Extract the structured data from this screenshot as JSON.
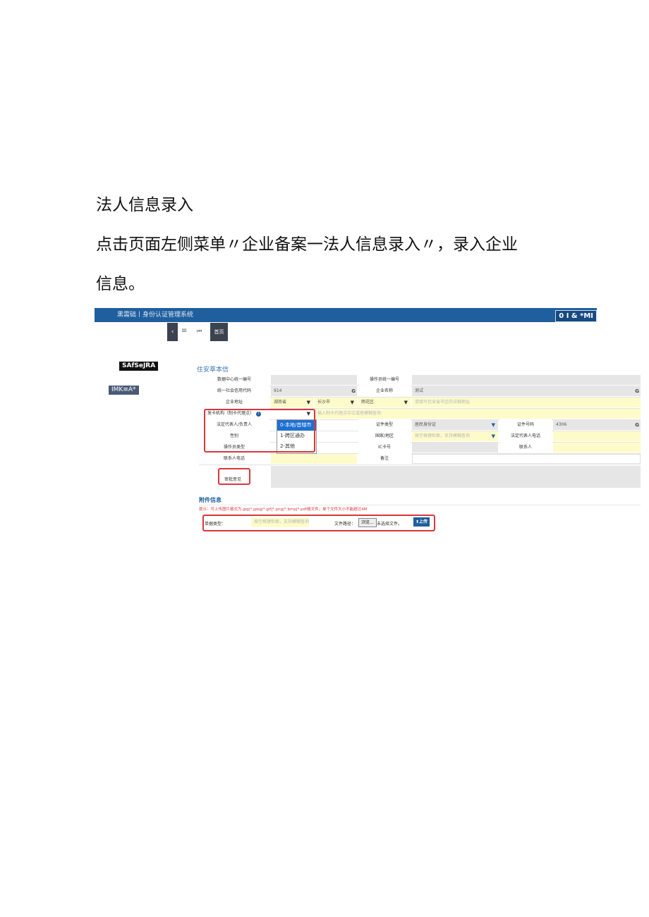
{
  "doc": {
    "heading": "法人信息录入",
    "paragraph_line1": "点击页面左侧菜单〃企业备案一法人信息录入〃，录入企业",
    "paragraph_line2": "信息。"
  },
  "screenshot": {
    "topbar": {
      "brand": "黑需础丨身份认证管理系统",
      "tools": "0 I & *MI"
    },
    "tabs": {
      "back_icon": "‹",
      "menu_icon": "≡",
      "prev_icon": "⏮",
      "home": "首页"
    },
    "sidebar": {
      "item1": "SAfSeJRA",
      "item2": "IMK≡A*"
    },
    "section_title": "住安萃本信",
    "form": {
      "r1": {
        "label_a": "数据中心统一编号",
        "label_b": "操作员统一编号"
      },
      "r2": {
        "label_a": "统一社会信用代码",
        "value_a": "914",
        "label_b": "企业名称",
        "value_b": "测试"
      },
      "r3": {
        "label_a": "企业地址",
        "province": "湖南省",
        "city": "长沙市",
        "district": "雨花区",
        "detail_ph": "请填写包含省市区的详细地址"
      },
      "r4": {
        "label_a": "发卡机构（制卡代理点）",
        "hint": "输入制卡代理点中文或者模糊查询"
      },
      "r5": {
        "label_a": "法定代表人/负责人",
        "label_b": "证件类型",
        "value_b": "居民身份证",
        "label_c": "证件号码",
        "value_c": "4306"
      },
      "r6": {
        "label_a": "性别",
        "label_b": "国家/地区",
        "value_b_ph": "按空格键检索，支持模糊查询",
        "label_c": "法定代表人电话"
      },
      "r7": {
        "label_a": "操作员类型",
        "label_b": "IC卡号",
        "label_c": "联系人"
      },
      "r8": {
        "label_a": "联系人电话",
        "label_b": "备注"
      },
      "approval": "审批意见"
    },
    "dropdown": {
      "options": [
        "0-本地/首辖市",
        "1-跨区通办",
        "2-其他"
      ],
      "selected_index": 0
    },
    "attachment": {
      "title": "附件信息",
      "note": "提示：可上传图片格式为.jpg|*.jpeg|*.gif|*.png|*.bmp|*.pdf格文件，单个文件大小不能超过4M",
      "type_label": "单据类型：",
      "type_ph": "按空格键检索，支持模糊查询",
      "path_label": "文件路径：",
      "browse": "浏览...",
      "no_file": "未选择文件。",
      "upload": "上传"
    },
    "colors": {
      "topbar": "#1f5f9e",
      "highlight_red": "#d9363e",
      "required_yellow": "#fdfbc9",
      "dropdown_selected": "#1f6fd1"
    }
  }
}
